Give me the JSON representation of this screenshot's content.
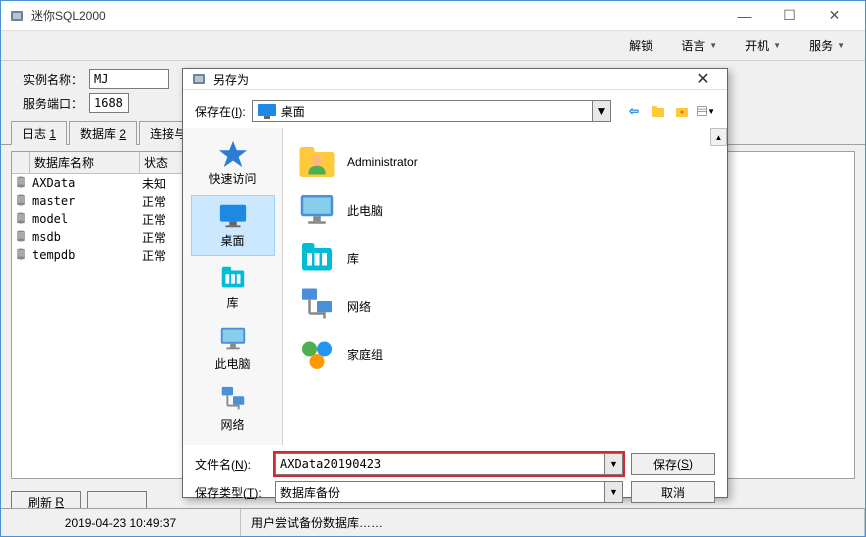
{
  "main": {
    "title": "迷你SQL2000",
    "toolbar": {
      "unlock": "解锁",
      "language": "语言",
      "power": "开机",
      "service": "服务"
    },
    "form": {
      "instance_label": "实例名称：",
      "instance_value": "MJ",
      "port_label": "服务端口：",
      "port_value": "1688"
    },
    "tabs": {
      "log": "日志",
      "log_key": "1",
      "db": "数据库",
      "db_key": "2",
      "conn": "连接与防火"
    },
    "grid": {
      "col1": "",
      "col2": "数据库名称",
      "col3": "状态",
      "rows": [
        {
          "name": "AXData",
          "status": "未知"
        },
        {
          "name": "master",
          "status": "正常"
        },
        {
          "name": "model",
          "status": "正常"
        },
        {
          "name": "msdb",
          "status": "正常"
        },
        {
          "name": "tempdb",
          "status": "正常"
        }
      ]
    },
    "buttons": {
      "refresh": "刷新",
      "refresh_key": "R"
    },
    "status": {
      "time": "2019-04-23 10:49:37",
      "msg": "用户尝试备份数据库……"
    }
  },
  "dialog": {
    "title": "另存为",
    "save_in_label": "保存在",
    "save_in_key": "I",
    "location": "桌面",
    "nav": {
      "back": "←",
      "up": "↑"
    },
    "places": [
      {
        "label": "快速访问",
        "icon": "star"
      },
      {
        "label": "桌面",
        "icon": "desktop",
        "selected": true
      },
      {
        "label": "库",
        "icon": "library"
      },
      {
        "label": "此电脑",
        "icon": "computer"
      },
      {
        "label": "网络",
        "icon": "network"
      }
    ],
    "files": [
      {
        "label": "Administrator",
        "icon": "user"
      },
      {
        "label": "此电脑",
        "icon": "computer"
      },
      {
        "label": "库",
        "icon": "library"
      },
      {
        "label": "网络",
        "icon": "network"
      },
      {
        "label": "家庭组",
        "icon": "homegroup"
      }
    ],
    "filename_label": "文件名",
    "filename_key": "N",
    "filename_value": "AXData20190423",
    "filetype_label": "保存类型",
    "filetype_key": "T",
    "filetype_value": "数据库备份",
    "save_btn": "保存",
    "save_key": "S",
    "cancel_btn": "取消"
  }
}
